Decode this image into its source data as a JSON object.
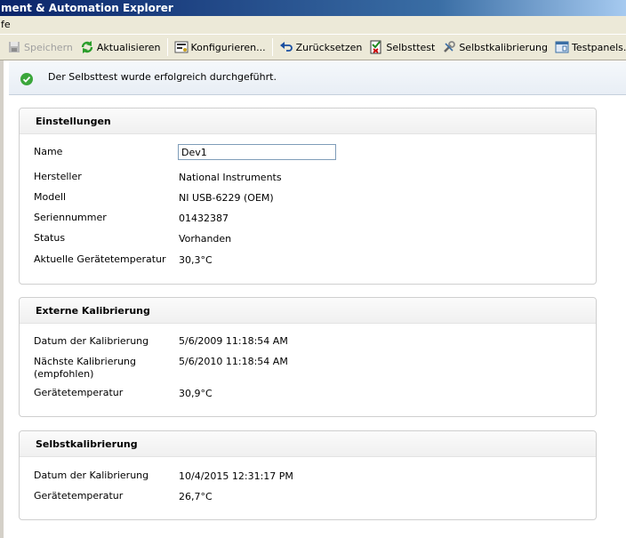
{
  "window": {
    "title": "ment & Automation Explorer"
  },
  "menu": {
    "item": "fe"
  },
  "toolbar": {
    "save": "Speichern",
    "refresh": "Aktualisieren",
    "configure": "Konfigurieren...",
    "reset": "Zurücksetzen",
    "selftest": "Selbsttest",
    "selfcal": "Selbstkalibrierung",
    "testpanels": "Testpanels..."
  },
  "notification": {
    "message": "Der Selbsttest wurde erfolgreich durchgeführt."
  },
  "settings": {
    "heading": "Einstellungen",
    "name_label": "Name",
    "name_value": "Dev1",
    "vendor_label": "Hersteller",
    "vendor_value": "National Instruments",
    "model_label": "Modell",
    "model_value": "NI USB-6229 (OEM)",
    "serial_label": "Seriennummer",
    "serial_value": "01432387",
    "status_label": "Status",
    "status_value": "Vorhanden",
    "temp_label": "Aktuelle Gerätetemperatur",
    "temp_value": "30,3°C"
  },
  "external_cal": {
    "heading": "Externe Kalibrierung",
    "date_label": "Datum der Kalibrierung",
    "date_value": "5/6/2009 11:18:54 AM",
    "next_label_line1": "Nächste Kalibrierung",
    "next_label_line2": "(empfohlen)",
    "next_value": "5/6/2010 11:18:54 AM",
    "temp_label": "Gerätetemperatur",
    "temp_value": "30,9°C"
  },
  "self_cal": {
    "heading": "Selbstkalibrierung",
    "date_label": "Datum der Kalibrierung",
    "date_value": "10/4/2015 12:31:17 PM",
    "temp_label": "Gerätetemperatur",
    "temp_value": "26,7°C"
  }
}
